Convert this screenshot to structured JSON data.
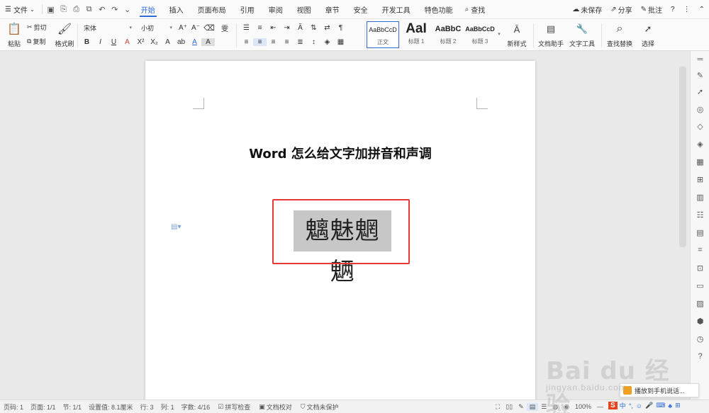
{
  "menubar": {
    "file": "文件",
    "tabs": [
      "开始",
      "插入",
      "页面布局",
      "引用",
      "审阅",
      "视图",
      "章节",
      "安全",
      "开发工具",
      "特色功能"
    ],
    "active_tab": "开始",
    "search": "查找",
    "unsaved": "未保存",
    "share": "分享",
    "comment": "批注",
    "help": "?"
  },
  "ribbon": {
    "paste": "粘贴",
    "cut": "剪切",
    "copy": "复制",
    "format_painter": "格式刷",
    "font_name": "宋体",
    "font_size": "小初",
    "styles": [
      {
        "preview": "AaBbCcD",
        "name": "正文"
      },
      {
        "preview": "AaI",
        "name": "标题 1"
      },
      {
        "preview": "AaBbC",
        "name": "标题 2"
      },
      {
        "preview": "AaBbCcD",
        "name": "标题 3"
      }
    ],
    "new_style": "新样式",
    "doc_assistant": "文档助手",
    "text_tools": "文字工具",
    "find_replace": "查找替换",
    "select": "选择"
  },
  "document": {
    "title": "Word 怎么给文字加拼音和声调",
    "selected_text": "魑魅魍魉"
  },
  "status": {
    "page_num": "页码: 1",
    "pages": "页面: 1/1",
    "section": "节: 1/1",
    "position": "设置值: 8.1厘米",
    "row": "行: 3",
    "col": "列: 1",
    "word_count": "字数: 4/16",
    "spell_check": "拼写检查",
    "doc_proof": "文档校对",
    "doc_protect": "文档未保护",
    "zoom": "100%"
  },
  "toast": {
    "text": "播放到手机说话..."
  },
  "watermark": {
    "line1": "Bai du 经验",
    "line2": "jingyan.baidu.com"
  },
  "colors": {
    "accent": "#2f6bd4",
    "highlight_box": "#e53935",
    "selection": "#c7c7c7"
  }
}
